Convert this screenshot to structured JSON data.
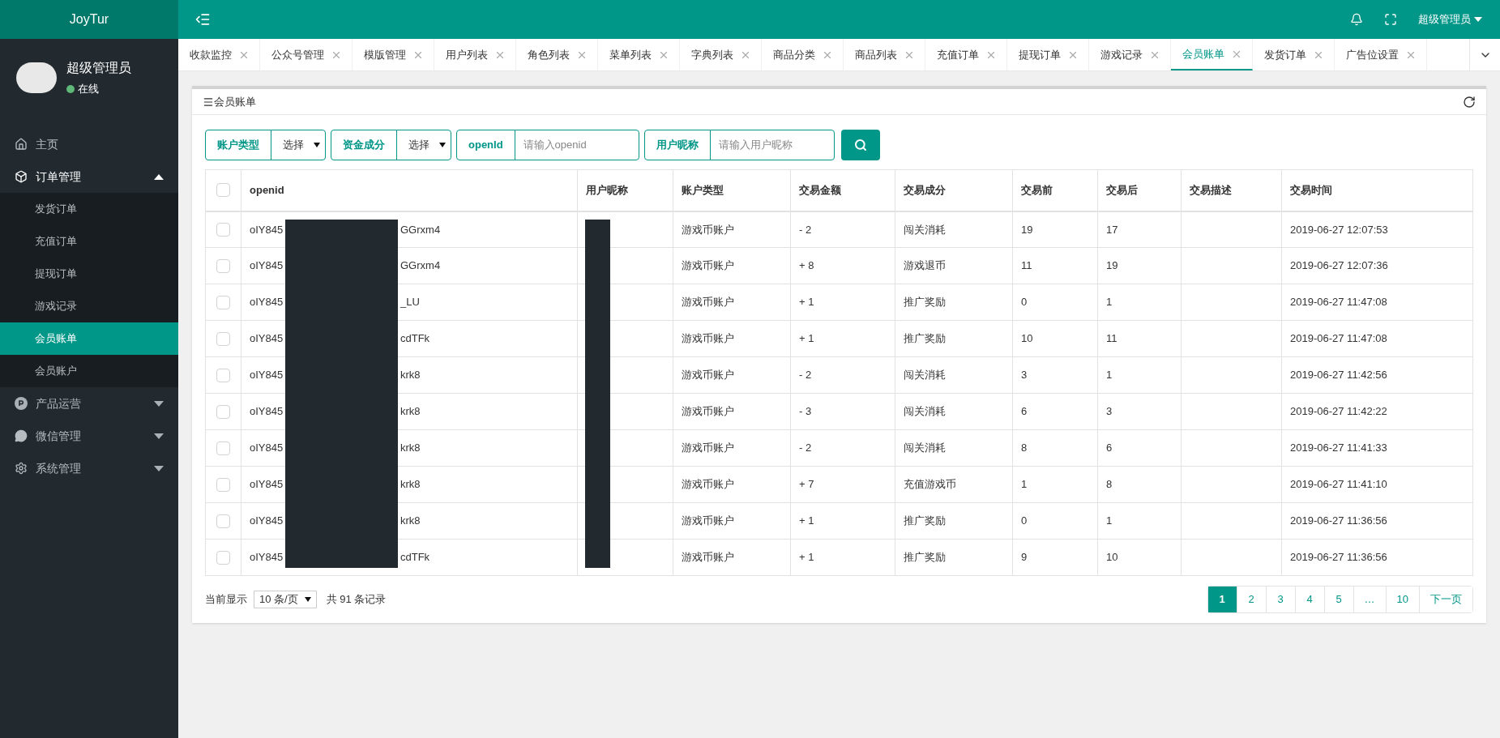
{
  "brand": "JoyTur",
  "header": {
    "user": "超级管理员"
  },
  "profile": {
    "name": "超级管理员",
    "status": "在线",
    "online": true
  },
  "sidebar": {
    "items": [
      {
        "label": "主页",
        "kind": "home",
        "expanded": false
      },
      {
        "label": "订单管理",
        "kind": "box",
        "expanded": true,
        "children": [
          {
            "label": "发货订单",
            "selected": false
          },
          {
            "label": "充值订单",
            "selected": false
          },
          {
            "label": "提现订单",
            "selected": false
          },
          {
            "label": "游戏记录",
            "selected": false
          },
          {
            "label": "会员账单",
            "selected": true
          },
          {
            "label": "会员账户",
            "selected": false
          }
        ]
      },
      {
        "label": "产品运营",
        "kind": "product",
        "expanded": false
      },
      {
        "label": "微信管理",
        "kind": "wechat",
        "expanded": false
      },
      {
        "label": "系统管理",
        "kind": "gear",
        "expanded": false
      }
    ]
  },
  "tabs": [
    {
      "label": "收款监控",
      "selected": false
    },
    {
      "label": "公众号管理",
      "selected": false
    },
    {
      "label": "模版管理",
      "selected": false
    },
    {
      "label": "用户列表",
      "selected": false
    },
    {
      "label": "角色列表",
      "selected": false
    },
    {
      "label": "菜单列表",
      "selected": false
    },
    {
      "label": "字典列表",
      "selected": false
    },
    {
      "label": "商品分类",
      "selected": false
    },
    {
      "label": "商品列表",
      "selected": false
    },
    {
      "label": "充值订单",
      "selected": false
    },
    {
      "label": "提现订单",
      "selected": false
    },
    {
      "label": "游戏记录",
      "selected": false
    },
    {
      "label": "会员账单",
      "selected": true
    },
    {
      "label": "发货订单",
      "selected": false
    },
    {
      "label": "广告位设置",
      "selected": false
    }
  ],
  "panel": {
    "title": "会员账单"
  },
  "filters": [
    {
      "kind": "select",
      "label": "账户类型",
      "value": "选择"
    },
    {
      "kind": "select",
      "label": "资金成分",
      "value": "选择"
    },
    {
      "kind": "input",
      "label": "openId",
      "placeholder": "请输入openid"
    },
    {
      "kind": "input",
      "label": "用户昵称",
      "placeholder": "请输入用户昵称"
    }
  ],
  "table": {
    "select_all_checked": false,
    "columns": [
      "openid",
      "用户昵称",
      "账户类型",
      "交易金额",
      "交易成分",
      "交易前",
      "交易后",
      "交易描述",
      "交易时间"
    ],
    "rows": [
      {
        "checked": false,
        "openid_start": "oIY845",
        "openid_end": "GGrxm4",
        "account_type": "游戏币账户",
        "amount": "- 2",
        "component": "闯关消耗",
        "before": "19",
        "after": "17",
        "time": "2019-06-27 12:07:53"
      },
      {
        "checked": false,
        "openid_start": "oIY845",
        "openid_end": "GGrxm4",
        "account_type": "游戏币账户",
        "amount": "+ 8",
        "component": "游戏退币",
        "before": "11",
        "after": "19",
        "time": "2019-06-27 12:07:36"
      },
      {
        "checked": false,
        "openid_start": "oIY845",
        "openid_end": "_LU",
        "account_type": "游戏币账户",
        "amount": "+ 1",
        "component": "推广奖励",
        "before": "0",
        "after": "1",
        "time": "2019-06-27 11:47:08"
      },
      {
        "checked": false,
        "openid_start": "oIY845",
        "openid_end": "cdTFk",
        "account_type": "游戏币账户",
        "amount": "+ 1",
        "component": "推广奖励",
        "before": "10",
        "after": "11",
        "time": "2019-06-27 11:47:08"
      },
      {
        "checked": false,
        "openid_start": "oIY845",
        "openid_end": "krk8",
        "account_type": "游戏币账户",
        "amount": "- 2",
        "component": "闯关消耗",
        "before": "3",
        "after": "1",
        "time": "2019-06-27 11:42:56"
      },
      {
        "checked": false,
        "openid_start": "oIY845",
        "openid_end": "krk8",
        "account_type": "游戏币账户",
        "amount": "- 3",
        "component": "闯关消耗",
        "before": "6",
        "after": "3",
        "time": "2019-06-27 11:42:22"
      },
      {
        "checked": false,
        "openid_start": "oIY845",
        "openid_end": "krk8",
        "account_type": "游戏币账户",
        "amount": "- 2",
        "component": "闯关消耗",
        "before": "8",
        "after": "6",
        "time": "2019-06-27 11:41:33"
      },
      {
        "checked": false,
        "openid_start": "oIY845",
        "openid_end": "krk8",
        "account_type": "游戏币账户",
        "amount": "+ 7",
        "component": "充值游戏币",
        "before": "1",
        "after": "8",
        "time": "2019-06-27 11:41:10"
      },
      {
        "checked": false,
        "openid_start": "oIY845",
        "openid_end": "krk8",
        "account_type": "游戏币账户",
        "amount": "+ 1",
        "component": "推广奖励",
        "before": "0",
        "after": "1",
        "time": "2019-06-27 11:36:56"
      },
      {
        "checked": false,
        "openid_start": "oIY845",
        "openid_end": "cdTFk",
        "account_type": "游戏币账户",
        "amount": "+ 1",
        "component": "推广奖励",
        "before": "9",
        "after": "10",
        "time": "2019-06-27 11:36:56"
      }
    ]
  },
  "footer": {
    "showing_label": "当前显示",
    "page_size": "10 条/页",
    "total": "共 91 条记录"
  },
  "pagination": [
    {
      "label": "1",
      "selected": true
    },
    {
      "label": "2",
      "selected": false
    },
    {
      "label": "3",
      "selected": false
    },
    {
      "label": "4",
      "selected": false
    },
    {
      "label": "5",
      "selected": false
    },
    {
      "label": "…",
      "selected": false
    },
    {
      "label": "10",
      "selected": false
    },
    {
      "label": "下一页",
      "selected": false
    }
  ]
}
